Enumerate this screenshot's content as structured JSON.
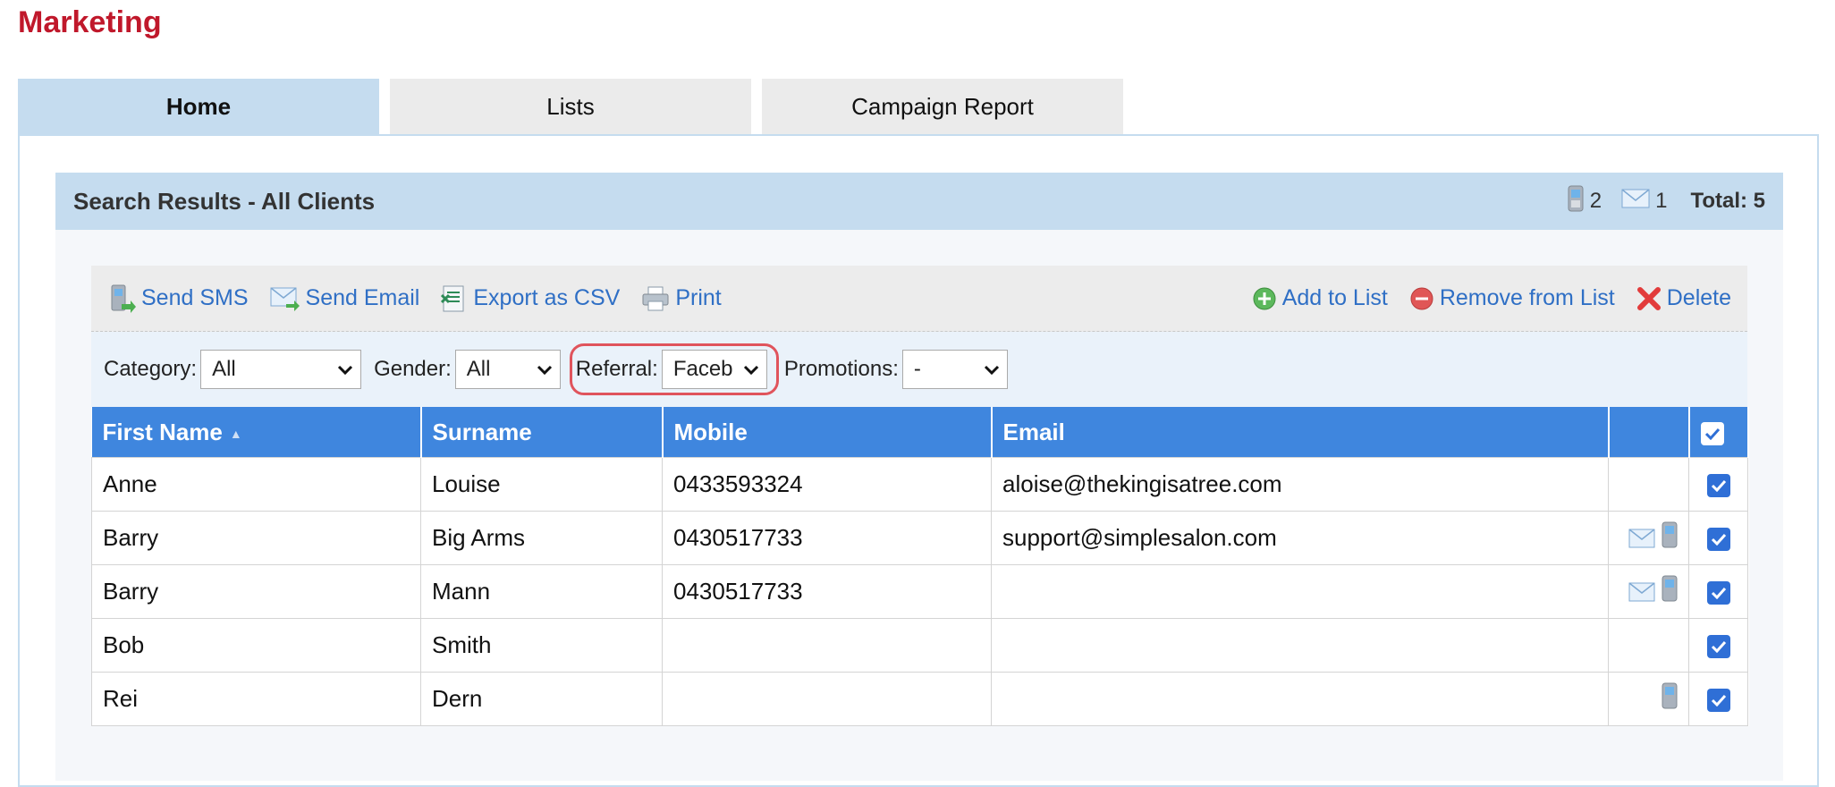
{
  "app": {
    "title": "Marketing"
  },
  "tabs": [
    {
      "label": "Home",
      "active": true
    },
    {
      "label": "Lists",
      "active": false
    },
    {
      "label": "Campaign Report",
      "active": false
    }
  ],
  "results": {
    "title": "Search Results - All Clients",
    "sms_count": "2",
    "email_count": "1",
    "total_label": "Total: 5"
  },
  "toolbar": {
    "send_sms": "Send SMS",
    "send_email": "Send Email",
    "export_csv": "Export as CSV",
    "print": "Print",
    "add_to_list": "Add to List",
    "remove_from_list": "Remove from List",
    "delete": "Delete"
  },
  "filters": {
    "category_label": "Category:",
    "category_value": "All",
    "gender_label": "Gender:",
    "gender_value": "All",
    "referral_label": "Referral:",
    "referral_value": "Faceb",
    "promotions_label": "Promotions:",
    "promotions_value": "-"
  },
  "table": {
    "headers": {
      "first_name": "First Name",
      "surname": "Surname",
      "mobile": "Mobile",
      "email": "Email"
    },
    "rows": [
      {
        "first": "Anne",
        "surname": "Louise",
        "mobile": "0433593324",
        "email": "aloise@thekingisatree.com",
        "has_email": false,
        "has_sms": false,
        "checked": true
      },
      {
        "first": "Barry",
        "surname": "Big Arms",
        "mobile": "0430517733",
        "email": "support@simplesalon.com",
        "has_email": true,
        "has_sms": true,
        "checked": true
      },
      {
        "first": "Barry",
        "surname": "Mann",
        "mobile": "0430517733",
        "email": "",
        "has_email": true,
        "has_sms": true,
        "checked": true
      },
      {
        "first": "Bob",
        "surname": "Smith",
        "mobile": "",
        "email": "",
        "has_email": false,
        "has_sms": false,
        "checked": true
      },
      {
        "first": "Rei",
        "surname": "Dern",
        "mobile": "",
        "email": "",
        "has_email": false,
        "has_sms": true,
        "checked": true
      }
    ]
  },
  "colors": {
    "title_red": "#c0182b",
    "header_blue": "#3f86de",
    "panel_blue": "#c5dcef",
    "link_blue": "#2f6fc5",
    "highlight_red": "#e0545c"
  }
}
